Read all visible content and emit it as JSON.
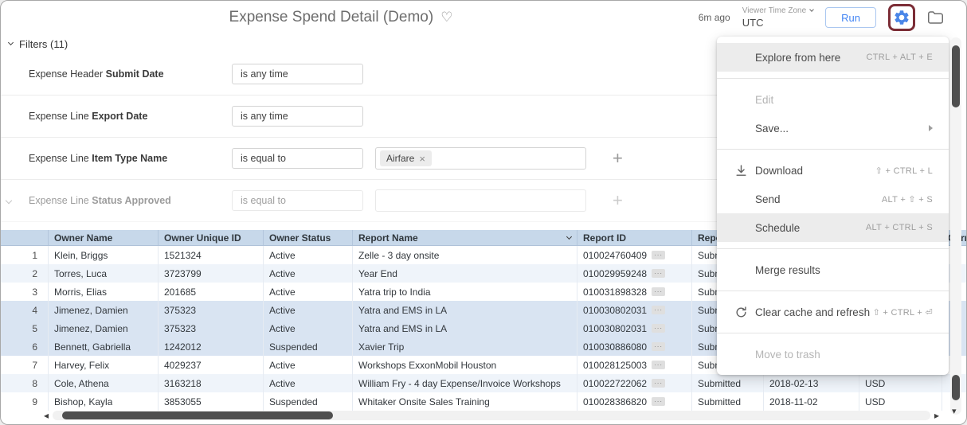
{
  "header": {
    "title": "Expense Spend Detail (Demo)",
    "favorite_icon": "♡",
    "last_run": "6m ago",
    "timezone_label": "Viewer Time Zone",
    "timezone_value": "UTC",
    "run_label": "Run"
  },
  "filters": {
    "toggle_label": "Filters (11)",
    "rows": [
      {
        "dimension": "Expense Header",
        "field": "Submit Date",
        "condition": "is any time",
        "values": [],
        "show_values_box": false,
        "show_add": false,
        "faded": false,
        "collapse_chevron": false
      },
      {
        "dimension": "Expense Line",
        "field": "Export Date",
        "condition": "is any time",
        "values": [],
        "show_values_box": false,
        "show_add": false,
        "faded": false,
        "collapse_chevron": false
      },
      {
        "dimension": "Expense Line",
        "field": "Item Type Name",
        "condition": "is equal to",
        "values": [
          "Airfare"
        ],
        "show_values_box": true,
        "show_add": true,
        "faded": false,
        "collapse_chevron": false
      },
      {
        "dimension": "Expense Line",
        "field": "Status Approved",
        "condition": "is equal to",
        "values": [],
        "show_values_box": true,
        "show_add": true,
        "faded": true,
        "collapse_chevron": true
      }
    ]
  },
  "menu": {
    "items": [
      {
        "label": "Explore from here",
        "shortcut": "CTRL + ALT + E",
        "highlighted": true
      },
      {
        "divider": true
      },
      {
        "label": "Edit",
        "disabled": true
      },
      {
        "label": "Save...",
        "submenu": true
      },
      {
        "divider": true
      },
      {
        "label": "Download",
        "icon": "download",
        "shortcut": "⇧ + CTRL + L"
      },
      {
        "label": "Send",
        "shortcut": "ALT + ⇧ + S"
      },
      {
        "label": "Schedule",
        "shortcut": "ALT + CTRL + S",
        "highlighted": true
      },
      {
        "divider": true
      },
      {
        "label": "Merge results"
      },
      {
        "divider": true
      },
      {
        "label": "Clear cache and refresh",
        "icon": "refresh",
        "shortcut": "⇧ + CTRL + ⏎"
      },
      {
        "divider": true
      },
      {
        "label": "Move to trash",
        "disabled": true
      }
    ]
  },
  "table": {
    "columns": [
      "",
      "Owner Name",
      "Owner Unique ID",
      "Owner Status",
      "Report Name",
      "Report ID",
      "Report Status",
      "",
      "",
      "Currency"
    ],
    "sorted_column_index": 4,
    "sort_direction": "desc",
    "highlighted_rows": [
      4,
      5,
      6
    ],
    "rows": [
      [
        "1",
        "Klein, Briggs",
        "1521324",
        "Active",
        "Zelle - 3 day onsite",
        "010024760409",
        "Submitted",
        "",
        "",
        ""
      ],
      [
        "2",
        "Torres, Luca",
        "3723799",
        "Active",
        "Year End",
        "010029959248",
        "Submitted",
        "",
        "",
        ""
      ],
      [
        "3",
        "Morris, Elias",
        "201685",
        "Active",
        "Yatra trip to India",
        "010031898328",
        "Submitted",
        "",
        "",
        ""
      ],
      [
        "4",
        "Jimenez, Damien",
        "375323",
        "Active",
        "Yatra and EMS in LA",
        "010030802031",
        "Submitted",
        "",
        "",
        ""
      ],
      [
        "5",
        "Jimenez, Damien",
        "375323",
        "Active",
        "Yatra and EMS in LA",
        "010030802031",
        "Submitted",
        "",
        "",
        ""
      ],
      [
        "6",
        "Bennett, Gabriella",
        "1242012",
        "Suspended",
        "Xavier Trip",
        "010030886080",
        "Submitted",
        "",
        "",
        ""
      ],
      [
        "7",
        "Harvey, Felix",
        "4029237",
        "Active",
        "Workshops ExxonMobil Houston",
        "010028125003",
        "Submitted",
        "",
        "",
        ""
      ],
      [
        "8",
        "Cole, Athena",
        "3163218",
        "Active",
        "William Fry - 4 day Expense/Invoice Workshops",
        "010022722062",
        "Submitted",
        "2018-02-13",
        "USD",
        ""
      ],
      [
        "9",
        "Bishop, Kayla",
        "3853055",
        "Suspended",
        "Whitaker Onsite Sales Training",
        "010028386820",
        "Submitted",
        "2018-11-02",
        "USD",
        ""
      ]
    ]
  },
  "colors": {
    "accent_blue": "#4285f4",
    "table_header_bg": "#c7d8ea",
    "row_stripe": "#eff4fa",
    "row_highlight": "#d9e4f2",
    "click_indicator": "#7c2d36"
  }
}
